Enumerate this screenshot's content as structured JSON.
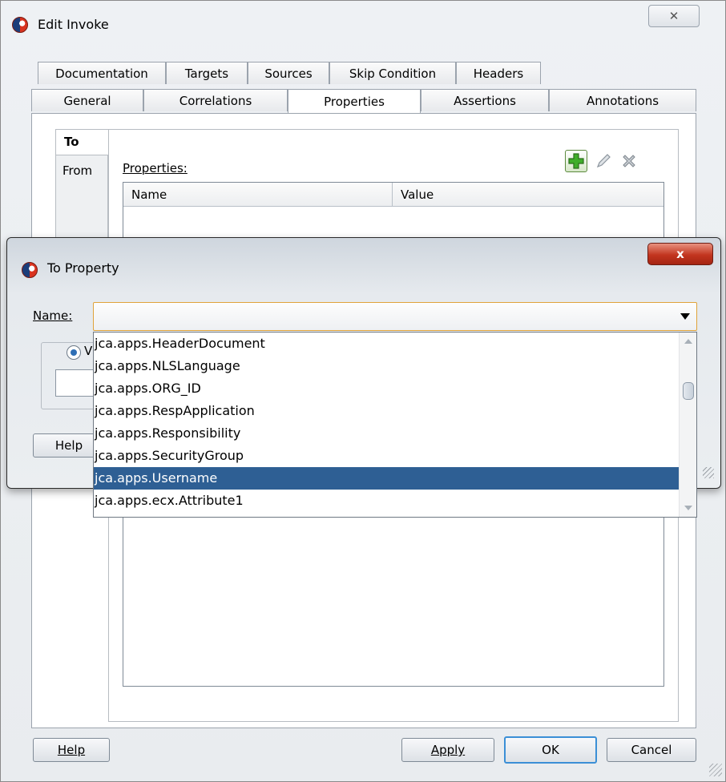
{
  "outer": {
    "title": "Edit Invoke",
    "close_glyph": "✕",
    "tabs_row1": [
      "Documentation",
      "Targets",
      "Sources",
      "Skip Condition",
      "Headers"
    ],
    "tabs_row2": [
      "General",
      "Correlations",
      "Properties",
      "Assertions",
      "Annotations"
    ],
    "active_tab": "Properties",
    "side_tabs": {
      "to": "To",
      "from": "From"
    },
    "properties_label": "Properties:",
    "table_columns": [
      "Name",
      "Value"
    ],
    "buttons": {
      "help": "Help",
      "apply": "Apply",
      "ok": "OK",
      "cancel": "Cancel"
    }
  },
  "inner": {
    "title": "To Property",
    "close_glyph": "x",
    "name_label": "Name:",
    "name_value": "",
    "radio_label_partial": "V",
    "help_partial": "Help",
    "dropdown_options": [
      "jca.apps.HeaderDocument",
      "jca.apps.NLSLanguage",
      "jca.apps.ORG_ID",
      "jca.apps.RespApplication",
      "jca.apps.Responsibility",
      "jca.apps.SecurityGroup",
      "jca.apps.Username",
      "jca.apps.ecx.Attribute1"
    ],
    "selected_option": "jca.apps.Username"
  },
  "colors": {
    "selection": "#2e5f94",
    "combo_focus_border": "#e0a33a",
    "close_red": "#c2351f",
    "add_green": "#3fae2a"
  }
}
